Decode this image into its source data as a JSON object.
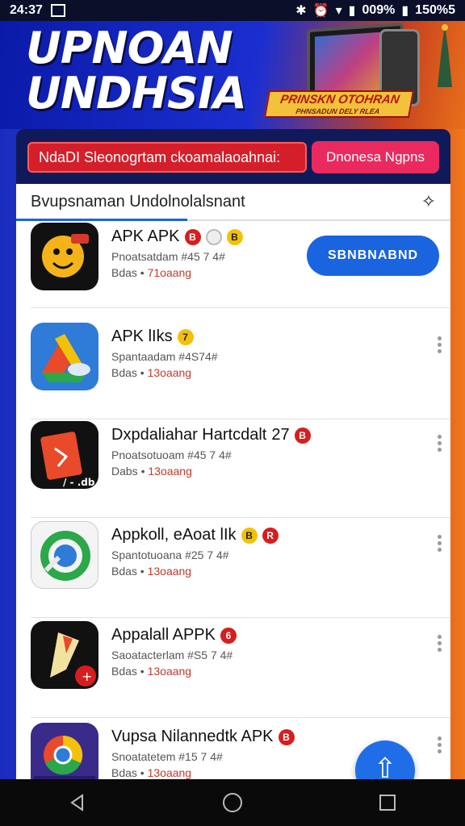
{
  "status_bar": {
    "time": "24:37",
    "battery_text": "009%",
    "extra_text": "150%5"
  },
  "banner": {
    "title_line1": "UPNOAN",
    "title_line2": "UNDHSIA",
    "tag_main": "PRINSKN OTOHRAN",
    "tag_sub": "PHNSADUN DELY RLEA"
  },
  "strip": {
    "notice": "NdaDI Sleonogrtam ckoamalaoahnai:",
    "cta_label": "Dnonesa Ngpns"
  },
  "panel": {
    "header_title": "Bvupsnaman Undolnolalsnant"
  },
  "apps": [
    {
      "name": "APK APK",
      "line1": "Pnoatsatdam #45 7 4#",
      "line2_a": "Bdas •",
      "line2_b": "71oaang",
      "badges": [
        "red",
        "white",
        "yellow"
      ],
      "badge_text": [
        "B",
        "",
        "B"
      ],
      "action": "SBNBNABND"
    },
    {
      "name": "APK lIks",
      "line1": "Spantaadam #4S74#",
      "line2_a": "Bdas •",
      "line2_b": "13oaang",
      "badges": [
        "yellow"
      ],
      "badge_text": [
        "7"
      ]
    },
    {
      "name": "Dxpdaliahar Hartcdalt",
      "name_suffix": "27",
      "line1": "Pnoatsotuoam #45 7 4#",
      "line2_a": "Dabs •",
      "line2_b": "13oaang",
      "badges": [
        "red"
      ],
      "badge_text": [
        "B"
      ]
    },
    {
      "name": "Appkoll, eAoat lIk",
      "line1": "Spantotuoana #25 7 4#",
      "line2_a": "Bdas •",
      "line2_b": "13oaang",
      "badges": [
        "yellow",
        "red"
      ],
      "badge_text": [
        "B",
        "R"
      ]
    },
    {
      "name": "Appalall APPK",
      "line1": "Saoatacterlam #S5 7 4#",
      "line2_a": "Bdas •",
      "line2_b": "13oaang",
      "badges": [
        "red"
      ],
      "badge_text": [
        "6"
      ]
    },
    {
      "name": "Vupsa Nilannedtk APK",
      "line1": "Snoatatetem #15 7 4#",
      "line2_a": "Bdas •",
      "line2_b": "13oaang",
      "badges": [
        "red"
      ],
      "badge_text": [
        "B"
      ]
    }
  ],
  "icon_colors": {
    "accent": "#1a64e0",
    "badge_red": "#d61e1e",
    "badge_yellow": "#f2c20a"
  }
}
